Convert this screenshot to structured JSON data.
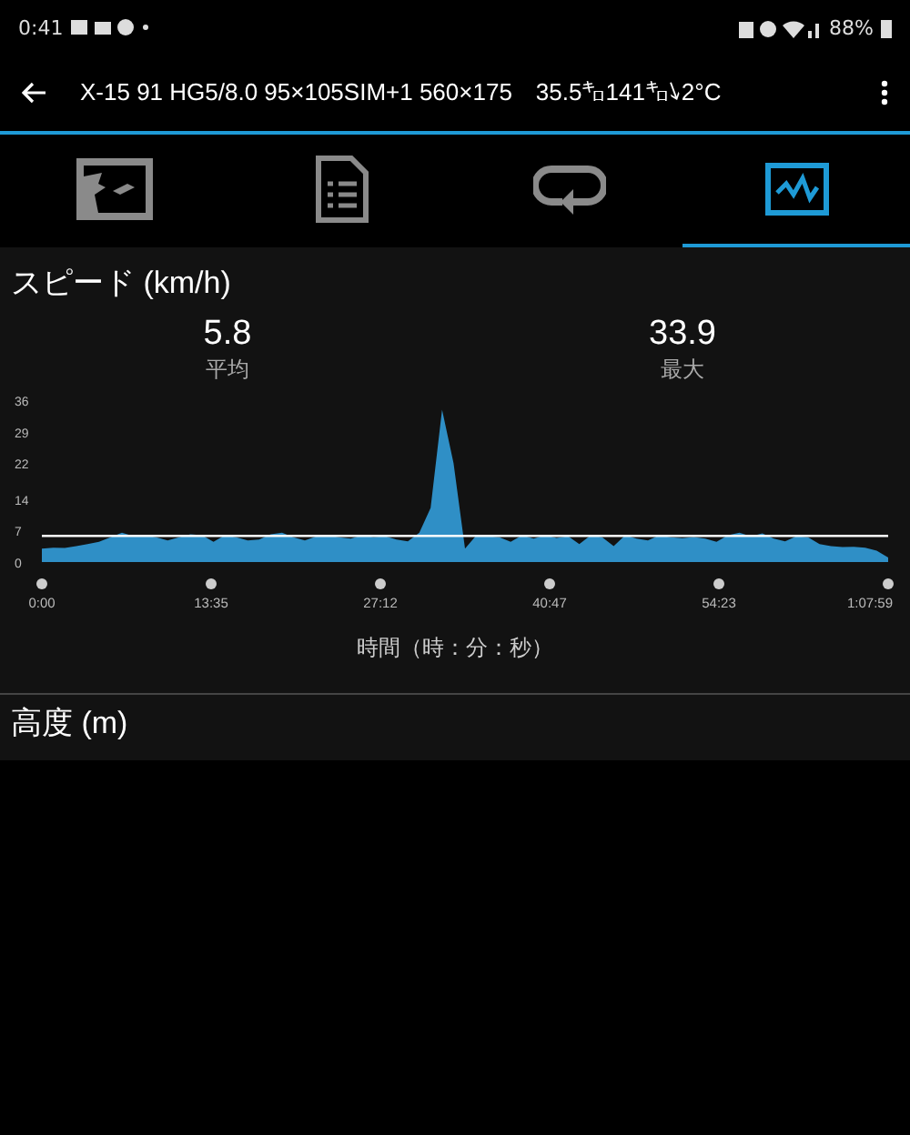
{
  "status_bar": {
    "time": "0:41",
    "battery": "88%"
  },
  "app_bar": {
    "title": "X-15 91 HG5/8.0 95×105SIM+1 560×175　35.5㌔141㌔↘2°C"
  },
  "tabs": [
    {
      "kind": "map",
      "selected": false
    },
    {
      "kind": "document",
      "selected": false
    },
    {
      "kind": "loop",
      "selected": false
    },
    {
      "kind": "chart",
      "selected": true
    }
  ],
  "section": {
    "title": "スピード (km/h)",
    "stats": [
      {
        "value": "5.8",
        "label": "平均"
      },
      {
        "value": "33.9",
        "label": "最大"
      }
    ],
    "chart_data": {
      "type": "area",
      "xlabel": "時間（時：分：秒）",
      "ylim": [
        0,
        36
      ],
      "yticks": [
        0,
        7,
        14,
        22,
        29,
        36
      ],
      "series": [
        {
          "color": "#2f8fc6",
          "values": [
            3,
            3.2,
            3.1,
            3.5,
            4,
            4.5,
            5.5,
            6.5,
            5.8,
            6,
            5.5,
            4.8,
            5.5,
            6.2,
            6,
            4.5,
            6,
            5.5,
            4.8,
            5,
            6.2,
            6.5,
            5.5,
            4.8,
            5.7,
            6,
            5.5,
            5.2,
            6,
            5.6,
            5.8,
            5,
            4.6,
            6.5,
            12,
            33.9,
            22,
            3,
            6,
            5.8,
            5.5,
            4.5,
            6,
            5.2,
            6,
            5.4,
            5.8,
            4,
            6,
            5.5,
            3.5,
            6,
            5.2,
            4.8,
            6,
            5.5,
            5.3,
            5.6,
            5.2,
            4.5,
            6,
            6.5,
            5.7,
            6.4,
            5.2,
            4.6,
            5.8,
            5.5,
            4,
            3.5,
            3.3,
            3.4,
            3.2,
            2.5,
            1
          ]
        }
      ]
    },
    "time_labels": [
      "0:00",
      "13:35",
      "27:12",
      "40:47",
      "54:23",
      "1:07:59"
    ]
  },
  "next_section": {
    "title": "高度 (m)"
  }
}
